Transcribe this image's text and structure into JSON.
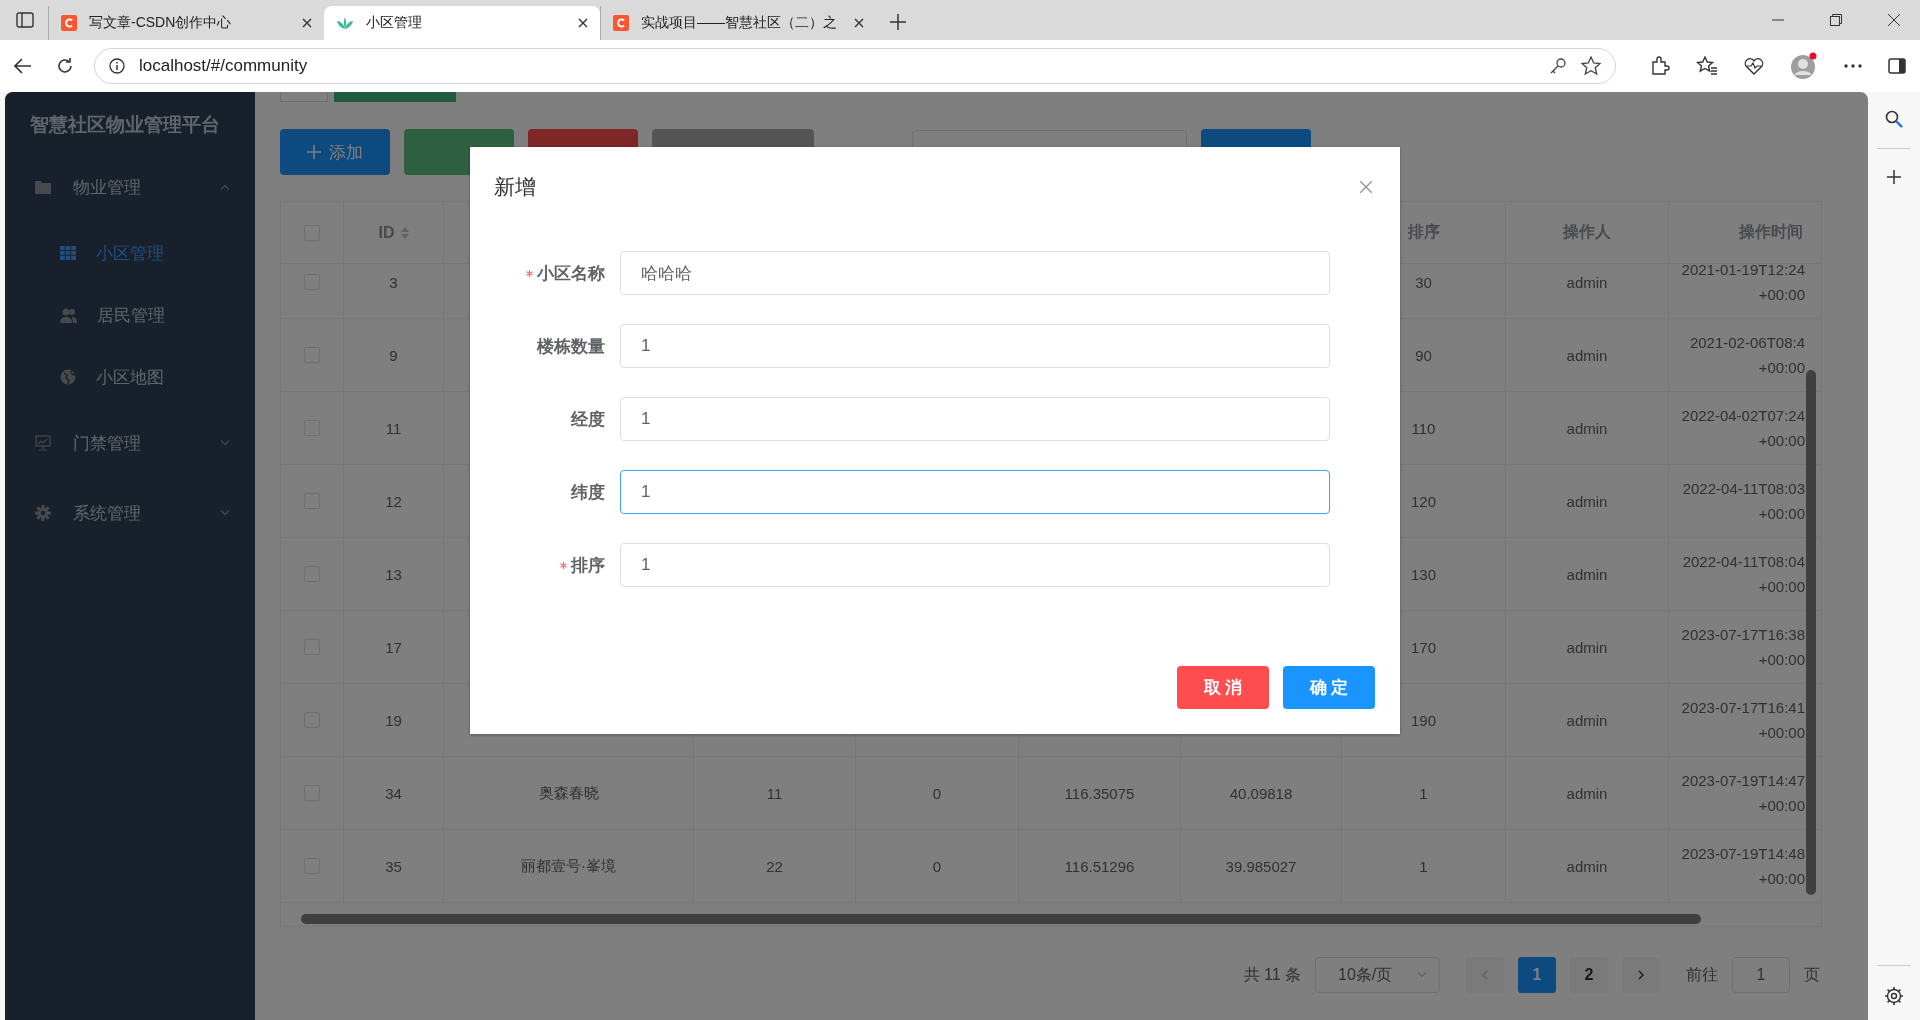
{
  "browser": {
    "tabs": [
      {
        "title": "写文章-CSDN创作中心",
        "selected": false
      },
      {
        "title": "小区管理",
        "selected": true
      },
      {
        "title": "实战项目——智慧社区（二）之",
        "selected": false
      }
    ],
    "address": "localhost/#/community"
  },
  "sidebar": {
    "title": "智慧社区物业管理平台",
    "items": [
      {
        "label": "物业管理",
        "expanded": true,
        "children": [
          {
            "label": "小区管理",
            "selected": true
          },
          {
            "label": "居民管理",
            "selected": false
          },
          {
            "label": "小区地图",
            "selected": false
          }
        ]
      },
      {
        "label": "门禁管理",
        "expanded": false
      },
      {
        "label": "系统管理",
        "expanded": false
      }
    ]
  },
  "toolbar": {
    "buttons": [
      {
        "label": "添加",
        "kind": "primary"
      },
      {
        "kind": "success"
      },
      {
        "kind": "danger"
      },
      {
        "kind": "info"
      },
      {
        "kind": "search"
      }
    ]
  },
  "table": {
    "header_checked": false,
    "columns": [
      "ID",
      "排序",
      "操作人",
      "操作时间"
    ],
    "rows": [
      {
        "checked": false,
        "id": "3",
        "sort": "30",
        "operator": "admin",
        "time": "2021-01-19T12:24",
        "zone": "+00:00"
      },
      {
        "checked": false,
        "id": "9",
        "sort": "90",
        "operator": "admin",
        "time": "2021-02-06T08:4",
        "zone": "+00:00"
      },
      {
        "checked": false,
        "id": "11",
        "sort": "110",
        "operator": "admin",
        "time": "2022-04-02T07:24",
        "zone": "+00:00"
      },
      {
        "checked": false,
        "id": "12",
        "sort": "120",
        "operator": "admin",
        "time": "2022-04-11T08:03",
        "zone": "+00:00"
      },
      {
        "checked": false,
        "id": "13",
        "sort": "130",
        "operator": "admin",
        "time": "2022-04-11T08:04",
        "zone": "+00:00"
      },
      {
        "checked": false,
        "id": "17",
        "sort": "170",
        "operator": "admin",
        "time": "2023-07-17T16:38",
        "zone": "+00:00"
      },
      {
        "checked": false,
        "id": "19",
        "sort": "190",
        "operator": "admin",
        "time": "2023-07-17T16:41",
        "zone": "+00:00"
      },
      {
        "checked": false,
        "id": "34",
        "name": "奥森春晓",
        "buildings": "11",
        "column_5": "0",
        "longitude": "116.35075",
        "latitude": "40.09818",
        "sort": "1",
        "operator": "admin",
        "time": "2023-07-19T14:47",
        "zone": "+00:00"
      },
      {
        "checked": false,
        "id": "35",
        "name": "丽都壹号·峯境",
        "buildings": "22",
        "column_5": "0",
        "longitude": "116.51296",
        "latitude": "39.985027",
        "sort": "1",
        "operator": "admin",
        "time": "2023-07-19T14:48",
        "zone": "+00:00"
      }
    ]
  },
  "pagination": {
    "total": "共 11 条",
    "page_size": "10条/页",
    "pages": [
      {
        "label": "1",
        "selected": true
      },
      {
        "label": "2",
        "selected": false
      }
    ],
    "goto_label": "前往",
    "goto_value": "1",
    "goto_suffix": "页"
  },
  "dialog": {
    "title": "新增",
    "fields": [
      {
        "label": "小区名称",
        "required": true,
        "value": "哈哈哈",
        "focused": false
      },
      {
        "label": "楼栋数量",
        "required": false,
        "value": "1",
        "focused": false
      },
      {
        "label": "经度",
        "required": false,
        "value": "1",
        "focused": false
      },
      {
        "label": "纬度",
        "required": false,
        "value": "1",
        "focused": true
      },
      {
        "label": "排序",
        "required": true,
        "value": "1",
        "focused": false
      }
    ],
    "buttons": [
      {
        "label": "取 消",
        "kind": "danger"
      },
      {
        "label": "确 定",
        "kind": "primary"
      }
    ]
  }
}
